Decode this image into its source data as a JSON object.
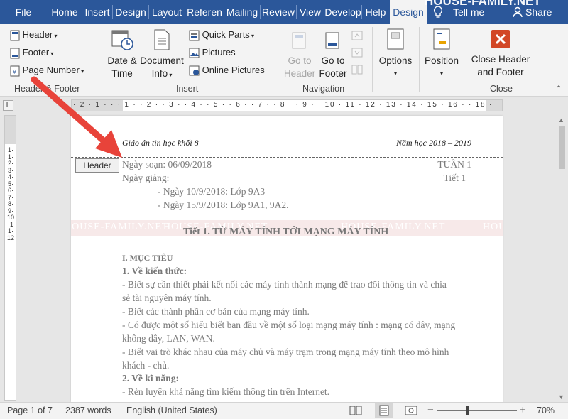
{
  "tabs": [
    {
      "label": "File",
      "x": 0
    },
    {
      "label": "Home"
    },
    {
      "label": "Insert"
    },
    {
      "label": "Design"
    },
    {
      "label": "Layout"
    },
    {
      "label": "Referen"
    },
    {
      "label": "Mailing"
    },
    {
      "label": "Review"
    },
    {
      "label": "View"
    },
    {
      "label": "Develop"
    },
    {
      "label": "Help"
    },
    {
      "label": "Design"
    }
  ],
  "tell_me": "Tell me",
  "share": "Share",
  "brand_watermark": "HOUSE-FAMILY.NET",
  "ribbon": {
    "header_footer": {
      "header": "Header",
      "footer": "Footer",
      "page_number": "Page Number",
      "group": "Header & Footer"
    },
    "insert": {
      "date_time_line1": "Date &",
      "date_time_line2": "Time",
      "document_info_line1": "Document",
      "document_info_line2": "Info",
      "quick_parts": "Quick Parts",
      "pictures": "Pictures",
      "online_pictures": "Online Pictures",
      "group": "Insert"
    },
    "navigation": {
      "goto_header_line1": "Go to",
      "goto_header_line2": "Header",
      "goto_footer_line1": "Go to",
      "goto_footer_line2": "Footer",
      "group": "Navigation"
    },
    "options": {
      "label": "Options"
    },
    "position": {
      "label": "Position"
    },
    "close": {
      "label_line1": "Close Header",
      "label_line2": "and Footer",
      "group": "Close"
    }
  },
  "ruler_text": "· 2 · 1 · · · 1 · · 2 · · 3 · · 4 · · 5 · · 6 · · 7 · · 8 · · 9 · · 10 · 11 · 12 · 13 · 14 · 15 · 16 · · 18 ·",
  "vruler_text": "1·1·2·3·4·5·6·7·8·9·10·11·12",
  "document": {
    "header_left": "Giáo án tin học khối 8",
    "header_right": "Năm học 2018 – 2019",
    "header_tag": "Header",
    "ngay_soan": "Ngày soạn: 06/09/2018",
    "tuan": "TUẦN 1",
    "ngay_giang": "Ngày giảng:",
    "tiet": "Tiết 1",
    "date1": "- Ngày 10/9/2018: Lớp 9A3",
    "date2": "- Ngày 15/9/2018: Lớp 9A1, 9A2.",
    "lesson_title": "Tiết 1. TỪ MÁY TÍNH TỚI MẠNG MÁY TÍNH",
    "muc_tieu": "I. MỤC TIÊU",
    "kien_thuc": "1. Về kiến thức:",
    "kt1a": "- Biết sự cần thiết phải kết nối các máy tính thành mạng để trao đổi thông tin và chia",
    "kt1b": "sẻ tài nguyên máy tính.",
    "kt2": "- Biết các thành phần cơ bản của mạng máy tính.",
    "kt3a": "- Có được một số hiểu biết ban đầu về một số loại mạng máy tính : mạng có dây, mạng",
    "kt3b": "không dây, LAN, WAN.",
    "kt4a": "- Biết vai trò khác nhau của máy chủ và máy trạm trong mạng máy tính theo mô hình",
    "kt4b": "khách - chủ.",
    "ki_nang": "2. Về kĩ năng:",
    "kn1": "- Rèn luyện khả năng tìm kiếm thông tin trên Internet."
  },
  "status": {
    "page": "Page 1 of 7",
    "words": "2387 words",
    "language": "English (United States)",
    "zoom_minus": "−",
    "zoom_plus": "+",
    "zoom": "70%"
  },
  "colors": {
    "ribbon_blue": "#2b579a",
    "close_red": "#d24726",
    "arrow_red": "#e8433a"
  }
}
